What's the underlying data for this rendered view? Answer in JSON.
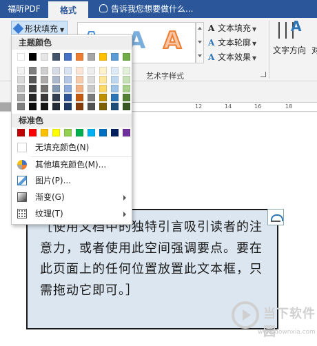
{
  "tabs": {
    "pdf": "福昕PDF",
    "active": "格式"
  },
  "tell_me": "告诉我您想要做什么...",
  "ribbon": {
    "shape_fill": "形状填充",
    "text_fill": "文本填充",
    "text_outline": "文本轮廓",
    "text_effects": "文本效果",
    "wordart_group": "艺术字样式",
    "text_direction": "文字方向",
    "cut_label": "对",
    "gallery": [
      "A",
      "A",
      "A"
    ],
    "text_icon": "A"
  },
  "menu": {
    "theme_colors": "主题颜色",
    "standard_colors": "标准色",
    "items": {
      "no_fill": "无填充颜色(N)",
      "more_colors": "其他填充颜色(M)...",
      "picture": "图片(P)...",
      "gradient": "渐变(G)",
      "texture": "纹理(T)"
    },
    "theme_palette": [
      [
        "#FFFFFF",
        "#F2F2F2",
        "#D9D9D9",
        "#BFBFBF",
        "#A6A6A6",
        "#808080"
      ],
      [
        "#000000",
        "#7F7F7F",
        "#595959",
        "#404040",
        "#262626",
        "#0D0D0D"
      ],
      [
        "#E7E6E6",
        "#D0CECE",
        "#AEAAAA",
        "#757171",
        "#3A3838",
        "#171616"
      ],
      [
        "#44546A",
        "#D6DCE5",
        "#ADB9CA",
        "#8497B0",
        "#333F50",
        "#222A35"
      ],
      [
        "#4472C4",
        "#DAE3F3",
        "#B4C7E7",
        "#8FAADC",
        "#2F5597",
        "#203864"
      ],
      [
        "#ED7D31",
        "#FBE5D6",
        "#F8CBAD",
        "#F4B183",
        "#C55A11",
        "#843C0C"
      ],
      [
        "#A5A5A5",
        "#EDEDED",
        "#DBDBDB",
        "#C9C9C9",
        "#7B7B7B",
        "#525252"
      ],
      [
        "#FFC000",
        "#FFF2CC",
        "#FFE699",
        "#FFD966",
        "#BF9000",
        "#7F6000"
      ],
      [
        "#5B9BD5",
        "#DEEBF7",
        "#BDD7EE",
        "#9DC3E6",
        "#2E75B6",
        "#1F4E79"
      ],
      [
        "#70AD47",
        "#E2F0D9",
        "#C5E0B4",
        "#A9D18E",
        "#548235",
        "#385723"
      ]
    ],
    "standard_palette": [
      "#C00000",
      "#FF0000",
      "#FFC000",
      "#FFFF00",
      "#92D050",
      "#00B050",
      "#00B0F0",
      "#0070C0",
      "#002060",
      "#7030A0"
    ]
  },
  "ruler_ticks": [
    "12",
    "14",
    "16",
    "18"
  ],
  "document": {
    "textbox_text": "［使用文档中的独特引言吸引读者的注意力，或者使用此空间强调要点。要在此页面上的任何位置放置此文本框，只需拖动它即可。］"
  },
  "watermark": {
    "name": "当下软件园",
    "url": "www.downxia.com"
  }
}
